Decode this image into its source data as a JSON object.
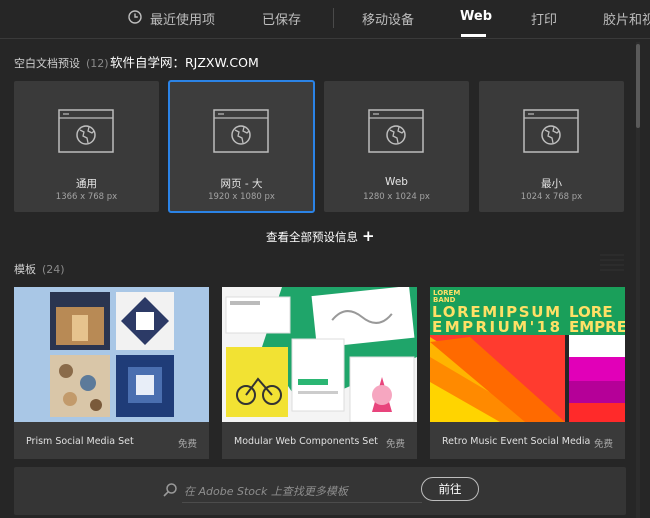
{
  "tabs": [
    {
      "label": "最近使用项"
    },
    {
      "label": "已保存"
    },
    {
      "label": "移动设备"
    },
    {
      "label": "Web"
    },
    {
      "label": "打印"
    },
    {
      "label": "胶片和视"
    }
  ],
  "active_tab": "Web",
  "presets_section": {
    "title": "空白文档预设",
    "count": "(12)"
  },
  "watermark": "软件自学网：RJZXW.COM",
  "presets": [
    {
      "name": "通用",
      "size": "1366 x 768 px"
    },
    {
      "name": "网页 - 大",
      "size": "1920 x 1080 px"
    },
    {
      "name": "Web",
      "size": "1280 x 1024 px"
    },
    {
      "name": "最小",
      "size": "1024 x 768 px"
    }
  ],
  "selected_preset": "网页 - 大",
  "view_all": "查看全部预设信息",
  "templates_section": {
    "title": "模板",
    "count": "(24)"
  },
  "templates": [
    {
      "name": "Prism Social Media Set",
      "badge": "免费"
    },
    {
      "name": "Modular Web Components Set",
      "badge": "免费"
    },
    {
      "name": "Retro Music Event Social Media S...",
      "badge": "免费"
    }
  ],
  "retro_thumb": {
    "line1": "LOREM",
    "line2": "BAND",
    "big1": "LOREMIPSUM",
    "big2": "EMPRIUM'18",
    "big3": "LORE",
    "big4": "EMPRE"
  },
  "search": {
    "placeholder": "在 Adobe Stock 上查找更多模板",
    "button": "前往"
  },
  "colors": {
    "accent": "#2b83e6",
    "background": "#262626",
    "card": "#3a3a3a"
  }
}
